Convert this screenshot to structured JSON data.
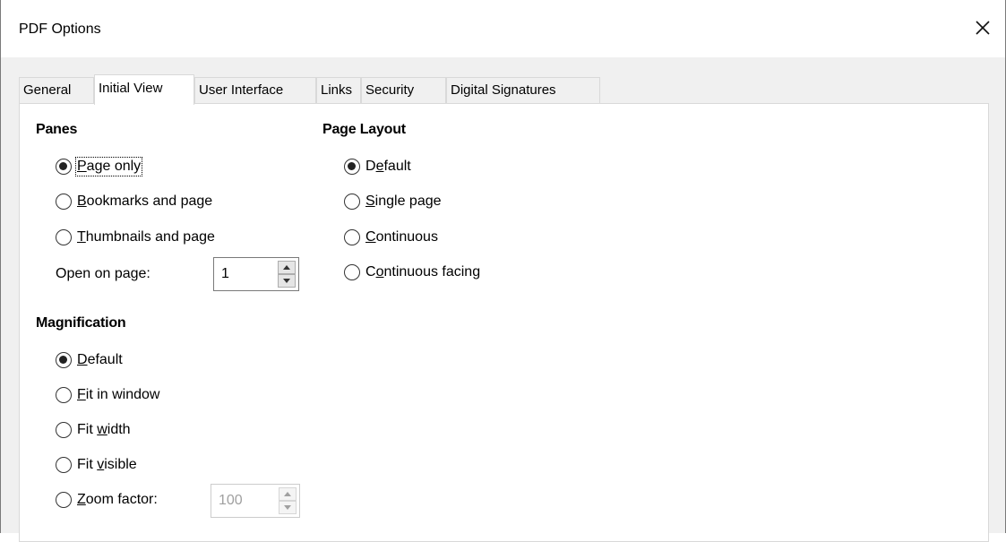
{
  "window": {
    "title": "PDF Options",
    "close_icon": "close-icon"
  },
  "tabs": [
    {
      "label": "General",
      "active": false
    },
    {
      "label": "Initial View",
      "active": true
    },
    {
      "label": "User Interface",
      "active": false
    },
    {
      "label": "Links",
      "active": false
    },
    {
      "label": "Security",
      "active": false
    },
    {
      "label": "Digital Signatures",
      "active": false
    }
  ],
  "panes": {
    "heading": "Panes",
    "options": [
      {
        "pre": "",
        "u": "P",
        "post": "age only",
        "checked": true
      },
      {
        "pre": "",
        "u": "B",
        "post": "ookmarks and page",
        "checked": false
      },
      {
        "pre": "",
        "u": "T",
        "post": "humbnails and page",
        "checked": false
      }
    ],
    "open_on_page": {
      "pre": "Open on pa",
      "u": "g",
      "post": "e:",
      "value": "1"
    }
  },
  "page_layout": {
    "heading": "Page Layout",
    "options": [
      {
        "pre": "D",
        "u": "e",
        "post": "fault",
        "checked": true
      },
      {
        "pre": "",
        "u": "S",
        "post": "ingle page",
        "checked": false
      },
      {
        "pre": "",
        "u": "C",
        "post": "ontinuous",
        "checked": false
      },
      {
        "pre": "C",
        "u": "o",
        "post": "ntinuous facing",
        "checked": false
      }
    ]
  },
  "magnification": {
    "heading": "Magnification",
    "options": [
      {
        "pre": "",
        "u": "D",
        "post": "efault",
        "checked": true
      },
      {
        "pre": "",
        "u": "F",
        "post": "it in window",
        "checked": false
      },
      {
        "pre": "Fit ",
        "u": "w",
        "post": "idth",
        "checked": false
      },
      {
        "pre": "Fit ",
        "u": "v",
        "post": "isible",
        "checked": false
      },
      {
        "pre": "",
        "u": "Z",
        "post": "oom factor:",
        "checked": false
      }
    ],
    "zoom_value": "100"
  }
}
